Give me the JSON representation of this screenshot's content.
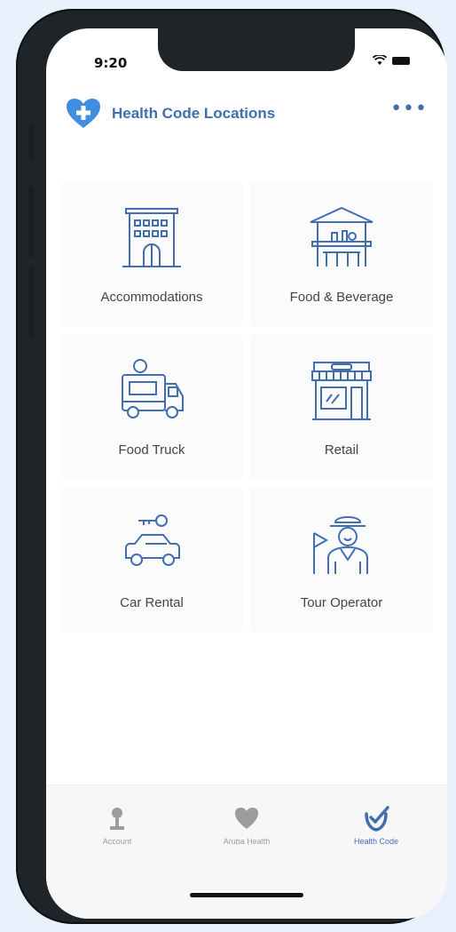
{
  "status_bar": {
    "time": "9:20"
  },
  "header": {
    "title": "Health Code Locations",
    "menu_label": "•••"
  },
  "categories": [
    {
      "label": "Accommodations",
      "icon": "hotel-building-icon"
    },
    {
      "label": "Food & Beverage",
      "icon": "bar-stools-icon"
    },
    {
      "label": "Food Truck",
      "icon": "food-truck-icon"
    },
    {
      "label": "Retail",
      "icon": "storefront-icon"
    },
    {
      "label": "Car Rental",
      "icon": "car-key-icon"
    },
    {
      "label": "Tour Operator",
      "icon": "tour-guide-flag-icon"
    }
  ],
  "tabbar": {
    "items": [
      {
        "label": "Account",
        "icon": "person-icon",
        "active": false
      },
      {
        "label": "Aruba Health",
        "icon": "heart-icon",
        "active": false
      },
      {
        "label": "Health Code",
        "icon": "shield-check-icon",
        "active": true
      }
    ]
  },
  "colors": {
    "primary": "#3f6fb0",
    "inactive": "#9c9c9c",
    "background": "#e6f1fb"
  }
}
